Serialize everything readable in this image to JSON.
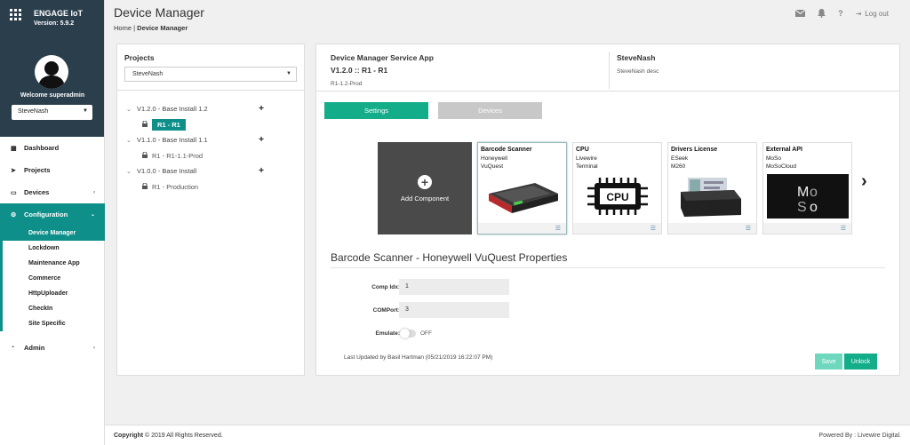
{
  "brand": {
    "name": "ENGAGE IoT",
    "version": "Version: 5.9.2"
  },
  "user": {
    "welcome": "Welcome superadmin",
    "project_select": "SteveNash"
  },
  "nav": {
    "dashboard": "Dashboard",
    "projects": "Projects",
    "devices": "Devices",
    "configuration": "Configuration",
    "config_items": [
      "Device Manager",
      "Lockdown",
      "Maintenance App",
      "Commerce",
      "HttpUploader",
      "CheckIn",
      "Site Specific"
    ],
    "admin": "Admin"
  },
  "header": {
    "title": "Device Manager",
    "breadcrumb_home": "Home",
    "breadcrumb_sep": "|",
    "breadcrumb_current": "Device Manager",
    "logout": "Log out"
  },
  "projects_panel": {
    "title": "Projects",
    "selected": "SteveNash",
    "tree": [
      {
        "label": "V1.2.0 - Base Install 1.2",
        "leaf": "R1 - R1"
      },
      {
        "label": "V1.1.0 - Base Install 1.1",
        "leaf": "R1 - R1-1.1-Prod"
      },
      {
        "label": "V1.0.0 - Base Install",
        "leaf": "R1 - Production"
      }
    ]
  },
  "main": {
    "app_name": "Device Manager Service App",
    "version_line": "V1.2.0 :: R1 - R1",
    "release_sub": "R1-1.2-Prod",
    "user_name": "SteveNash",
    "user_desc": "SteveNash desc",
    "tab_settings": "Settings",
    "tab_devices": "Devices",
    "add_component": "Add Component",
    "components": [
      {
        "title": "Barcode Scanner",
        "line1": "Honeywell",
        "line2": "VuQuest"
      },
      {
        "title": "CPU",
        "line1": "Livewire",
        "line2": "Terminal"
      },
      {
        "title": "Drivers License",
        "line1": "ESeek",
        "line2": "M260"
      },
      {
        "title": "External API",
        "line1": "MoSo",
        "line2": "MoSoCloud"
      }
    ],
    "cpu_chip_label": "CPU",
    "props_title": "Barcode Scanner - Honeywell VuQuest Properties",
    "comp_idx_label": "Comp Idx:",
    "comp_idx_value": "1",
    "comport_label": "COMPort:",
    "comport_value": "3",
    "emulate_label": "Emulate:",
    "emulate_value": "OFF",
    "last_updated": "Last Updated by Basil Hartman (05/21/2019 16:22:07 PM)",
    "save": "Save",
    "unlock": "Unlock"
  },
  "footer": {
    "copyright_bold": "Copyright",
    "copyright_rest": "© 2019 All Rights Reserved.",
    "powered": "Powered By : Livewire Digital."
  },
  "colors": {
    "teal": "#0f8f8a",
    "green": "#13ad8a",
    "sidebar_dark": "#2a3e4c"
  }
}
